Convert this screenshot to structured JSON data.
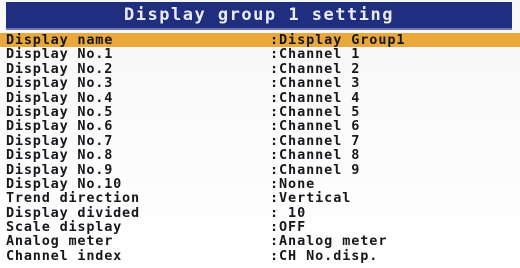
{
  "title": "Display group 1 setting",
  "rows": [
    {
      "label": "Display name",
      "value": ":Display Group1"
    },
    {
      "label": "Display No.1",
      "value": ":Channel 1"
    },
    {
      "label": "Display No.2",
      "value": ":Channel 2"
    },
    {
      "label": "Display No.3",
      "value": ":Channel 3"
    },
    {
      "label": "Display No.4",
      "value": ":Channel 4"
    },
    {
      "label": "Display No.5",
      "value": ":Channel 5"
    },
    {
      "label": "Display No.6",
      "value": ":Channel 6"
    },
    {
      "label": "Display No.7",
      "value": ":Channel 7"
    },
    {
      "label": "Display No.8",
      "value": ":Channel 8"
    },
    {
      "label": "Display No.9",
      "value": ":Channel 9"
    },
    {
      "label": "Display No.10",
      "value": ":None"
    },
    {
      "label": "Trend direction",
      "value": ":Vertical"
    },
    {
      "label": "Display divided",
      "value": ": 10"
    },
    {
      "label": "Scale display",
      "value": ":OFF"
    },
    {
      "label": "Analog meter",
      "value": ":Analog meter"
    },
    {
      "label": "Channel index",
      "value": ":CH No.disp."
    }
  ],
  "selected_index": 0,
  "colors": {
    "title_bar": "#202f82",
    "title_text": "#f2f3ff",
    "highlight": "#f0ac3e",
    "text": "#16181d",
    "background": "#ffffff"
  }
}
